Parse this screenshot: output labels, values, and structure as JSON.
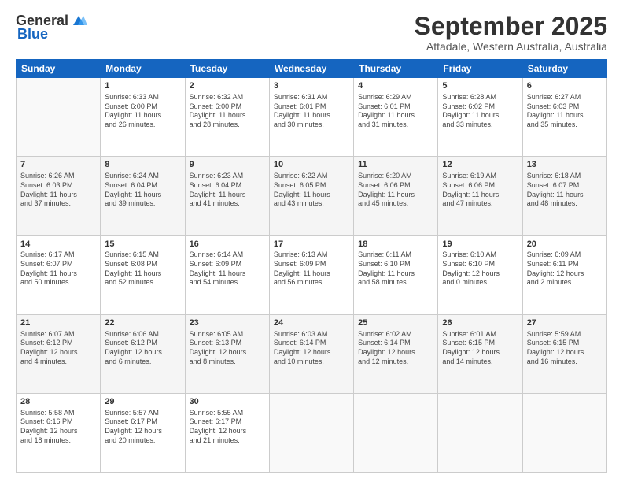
{
  "header": {
    "logo_general": "General",
    "logo_blue": "Blue",
    "month_title": "September 2025",
    "subtitle": "Attadale, Western Australia, Australia"
  },
  "weekdays": [
    "Sunday",
    "Monday",
    "Tuesday",
    "Wednesday",
    "Thursday",
    "Friday",
    "Saturday"
  ],
  "weeks": [
    [
      {
        "day": "",
        "info": ""
      },
      {
        "day": "1",
        "info": "Sunrise: 6:33 AM\nSunset: 6:00 PM\nDaylight: 11 hours\nand 26 minutes."
      },
      {
        "day": "2",
        "info": "Sunrise: 6:32 AM\nSunset: 6:00 PM\nDaylight: 11 hours\nand 28 minutes."
      },
      {
        "day": "3",
        "info": "Sunrise: 6:31 AM\nSunset: 6:01 PM\nDaylight: 11 hours\nand 30 minutes."
      },
      {
        "day": "4",
        "info": "Sunrise: 6:29 AM\nSunset: 6:01 PM\nDaylight: 11 hours\nand 31 minutes."
      },
      {
        "day": "5",
        "info": "Sunrise: 6:28 AM\nSunset: 6:02 PM\nDaylight: 11 hours\nand 33 minutes."
      },
      {
        "day": "6",
        "info": "Sunrise: 6:27 AM\nSunset: 6:03 PM\nDaylight: 11 hours\nand 35 minutes."
      }
    ],
    [
      {
        "day": "7",
        "info": "Sunrise: 6:26 AM\nSunset: 6:03 PM\nDaylight: 11 hours\nand 37 minutes."
      },
      {
        "day": "8",
        "info": "Sunrise: 6:24 AM\nSunset: 6:04 PM\nDaylight: 11 hours\nand 39 minutes."
      },
      {
        "day": "9",
        "info": "Sunrise: 6:23 AM\nSunset: 6:04 PM\nDaylight: 11 hours\nand 41 minutes."
      },
      {
        "day": "10",
        "info": "Sunrise: 6:22 AM\nSunset: 6:05 PM\nDaylight: 11 hours\nand 43 minutes."
      },
      {
        "day": "11",
        "info": "Sunrise: 6:20 AM\nSunset: 6:06 PM\nDaylight: 11 hours\nand 45 minutes."
      },
      {
        "day": "12",
        "info": "Sunrise: 6:19 AM\nSunset: 6:06 PM\nDaylight: 11 hours\nand 47 minutes."
      },
      {
        "day": "13",
        "info": "Sunrise: 6:18 AM\nSunset: 6:07 PM\nDaylight: 11 hours\nand 48 minutes."
      }
    ],
    [
      {
        "day": "14",
        "info": "Sunrise: 6:17 AM\nSunset: 6:07 PM\nDaylight: 11 hours\nand 50 minutes."
      },
      {
        "day": "15",
        "info": "Sunrise: 6:15 AM\nSunset: 6:08 PM\nDaylight: 11 hours\nand 52 minutes."
      },
      {
        "day": "16",
        "info": "Sunrise: 6:14 AM\nSunset: 6:09 PM\nDaylight: 11 hours\nand 54 minutes."
      },
      {
        "day": "17",
        "info": "Sunrise: 6:13 AM\nSunset: 6:09 PM\nDaylight: 11 hours\nand 56 minutes."
      },
      {
        "day": "18",
        "info": "Sunrise: 6:11 AM\nSunset: 6:10 PM\nDaylight: 11 hours\nand 58 minutes."
      },
      {
        "day": "19",
        "info": "Sunrise: 6:10 AM\nSunset: 6:10 PM\nDaylight: 12 hours\nand 0 minutes."
      },
      {
        "day": "20",
        "info": "Sunrise: 6:09 AM\nSunset: 6:11 PM\nDaylight: 12 hours\nand 2 minutes."
      }
    ],
    [
      {
        "day": "21",
        "info": "Sunrise: 6:07 AM\nSunset: 6:12 PM\nDaylight: 12 hours\nand 4 minutes."
      },
      {
        "day": "22",
        "info": "Sunrise: 6:06 AM\nSunset: 6:12 PM\nDaylight: 12 hours\nand 6 minutes."
      },
      {
        "day": "23",
        "info": "Sunrise: 6:05 AM\nSunset: 6:13 PM\nDaylight: 12 hours\nand 8 minutes."
      },
      {
        "day": "24",
        "info": "Sunrise: 6:03 AM\nSunset: 6:14 PM\nDaylight: 12 hours\nand 10 minutes."
      },
      {
        "day": "25",
        "info": "Sunrise: 6:02 AM\nSunset: 6:14 PM\nDaylight: 12 hours\nand 12 minutes."
      },
      {
        "day": "26",
        "info": "Sunrise: 6:01 AM\nSunset: 6:15 PM\nDaylight: 12 hours\nand 14 minutes."
      },
      {
        "day": "27",
        "info": "Sunrise: 5:59 AM\nSunset: 6:15 PM\nDaylight: 12 hours\nand 16 minutes."
      }
    ],
    [
      {
        "day": "28",
        "info": "Sunrise: 5:58 AM\nSunset: 6:16 PM\nDaylight: 12 hours\nand 18 minutes."
      },
      {
        "day": "29",
        "info": "Sunrise: 5:57 AM\nSunset: 6:17 PM\nDaylight: 12 hours\nand 20 minutes."
      },
      {
        "day": "30",
        "info": "Sunrise: 5:55 AM\nSunset: 6:17 PM\nDaylight: 12 hours\nand 21 minutes."
      },
      {
        "day": "",
        "info": ""
      },
      {
        "day": "",
        "info": ""
      },
      {
        "day": "",
        "info": ""
      },
      {
        "day": "",
        "info": ""
      }
    ]
  ]
}
